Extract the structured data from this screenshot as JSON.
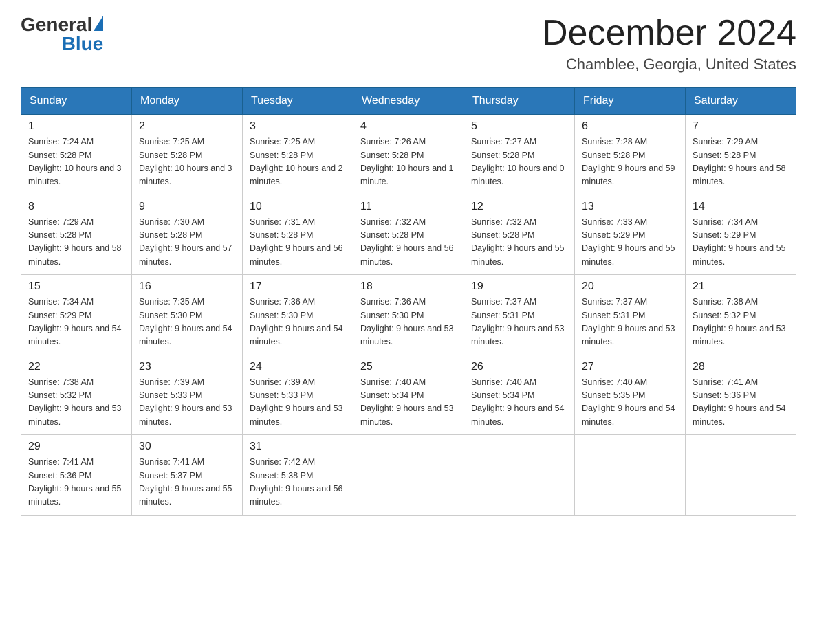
{
  "header": {
    "logo": {
      "general": "General",
      "blue": "Blue"
    },
    "title": "December 2024",
    "location": "Chamblee, Georgia, United States"
  },
  "weekdays": [
    "Sunday",
    "Monday",
    "Tuesday",
    "Wednesday",
    "Thursday",
    "Friday",
    "Saturday"
  ],
  "weeks": [
    [
      {
        "day": "1",
        "sunrise": "7:24 AM",
        "sunset": "5:28 PM",
        "daylight": "10 hours and 3 minutes."
      },
      {
        "day": "2",
        "sunrise": "7:25 AM",
        "sunset": "5:28 PM",
        "daylight": "10 hours and 3 minutes."
      },
      {
        "day": "3",
        "sunrise": "7:25 AM",
        "sunset": "5:28 PM",
        "daylight": "10 hours and 2 minutes."
      },
      {
        "day": "4",
        "sunrise": "7:26 AM",
        "sunset": "5:28 PM",
        "daylight": "10 hours and 1 minute."
      },
      {
        "day": "5",
        "sunrise": "7:27 AM",
        "sunset": "5:28 PM",
        "daylight": "10 hours and 0 minutes."
      },
      {
        "day": "6",
        "sunrise": "7:28 AM",
        "sunset": "5:28 PM",
        "daylight": "9 hours and 59 minutes."
      },
      {
        "day": "7",
        "sunrise": "7:29 AM",
        "sunset": "5:28 PM",
        "daylight": "9 hours and 58 minutes."
      }
    ],
    [
      {
        "day": "8",
        "sunrise": "7:29 AM",
        "sunset": "5:28 PM",
        "daylight": "9 hours and 58 minutes."
      },
      {
        "day": "9",
        "sunrise": "7:30 AM",
        "sunset": "5:28 PM",
        "daylight": "9 hours and 57 minutes."
      },
      {
        "day": "10",
        "sunrise": "7:31 AM",
        "sunset": "5:28 PM",
        "daylight": "9 hours and 56 minutes."
      },
      {
        "day": "11",
        "sunrise": "7:32 AM",
        "sunset": "5:28 PM",
        "daylight": "9 hours and 56 minutes."
      },
      {
        "day": "12",
        "sunrise": "7:32 AM",
        "sunset": "5:28 PM",
        "daylight": "9 hours and 55 minutes."
      },
      {
        "day": "13",
        "sunrise": "7:33 AM",
        "sunset": "5:29 PM",
        "daylight": "9 hours and 55 minutes."
      },
      {
        "day": "14",
        "sunrise": "7:34 AM",
        "sunset": "5:29 PM",
        "daylight": "9 hours and 55 minutes."
      }
    ],
    [
      {
        "day": "15",
        "sunrise": "7:34 AM",
        "sunset": "5:29 PM",
        "daylight": "9 hours and 54 minutes."
      },
      {
        "day": "16",
        "sunrise": "7:35 AM",
        "sunset": "5:30 PM",
        "daylight": "9 hours and 54 minutes."
      },
      {
        "day": "17",
        "sunrise": "7:36 AM",
        "sunset": "5:30 PM",
        "daylight": "9 hours and 54 minutes."
      },
      {
        "day": "18",
        "sunrise": "7:36 AM",
        "sunset": "5:30 PM",
        "daylight": "9 hours and 53 minutes."
      },
      {
        "day": "19",
        "sunrise": "7:37 AM",
        "sunset": "5:31 PM",
        "daylight": "9 hours and 53 minutes."
      },
      {
        "day": "20",
        "sunrise": "7:37 AM",
        "sunset": "5:31 PM",
        "daylight": "9 hours and 53 minutes."
      },
      {
        "day": "21",
        "sunrise": "7:38 AM",
        "sunset": "5:32 PM",
        "daylight": "9 hours and 53 minutes."
      }
    ],
    [
      {
        "day": "22",
        "sunrise": "7:38 AM",
        "sunset": "5:32 PM",
        "daylight": "9 hours and 53 minutes."
      },
      {
        "day": "23",
        "sunrise": "7:39 AM",
        "sunset": "5:33 PM",
        "daylight": "9 hours and 53 minutes."
      },
      {
        "day": "24",
        "sunrise": "7:39 AM",
        "sunset": "5:33 PM",
        "daylight": "9 hours and 53 minutes."
      },
      {
        "day": "25",
        "sunrise": "7:40 AM",
        "sunset": "5:34 PM",
        "daylight": "9 hours and 53 minutes."
      },
      {
        "day": "26",
        "sunrise": "7:40 AM",
        "sunset": "5:34 PM",
        "daylight": "9 hours and 54 minutes."
      },
      {
        "day": "27",
        "sunrise": "7:40 AM",
        "sunset": "5:35 PM",
        "daylight": "9 hours and 54 minutes."
      },
      {
        "day": "28",
        "sunrise": "7:41 AM",
        "sunset": "5:36 PM",
        "daylight": "9 hours and 54 minutes."
      }
    ],
    [
      {
        "day": "29",
        "sunrise": "7:41 AM",
        "sunset": "5:36 PM",
        "daylight": "9 hours and 55 minutes."
      },
      {
        "day": "30",
        "sunrise": "7:41 AM",
        "sunset": "5:37 PM",
        "daylight": "9 hours and 55 minutes."
      },
      {
        "day": "31",
        "sunrise": "7:42 AM",
        "sunset": "5:38 PM",
        "daylight": "9 hours and 56 minutes."
      },
      null,
      null,
      null,
      null
    ]
  ],
  "labels": {
    "sunrise": "Sunrise:",
    "sunset": "Sunset:",
    "daylight": "Daylight:"
  }
}
